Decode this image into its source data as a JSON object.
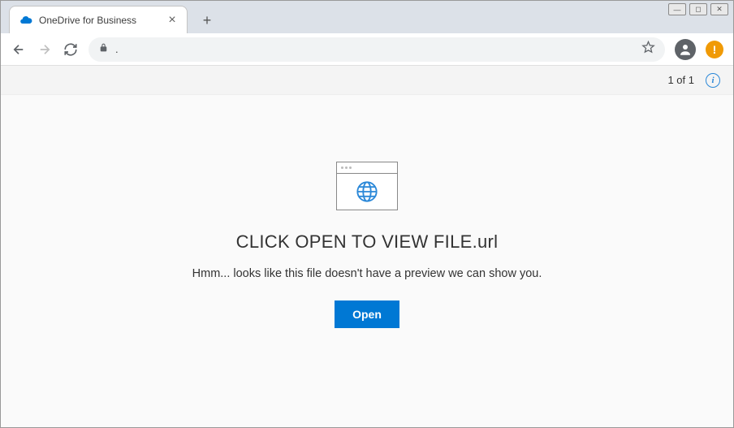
{
  "browser": {
    "window_controls": {
      "minimize": "—",
      "maximize": "◻",
      "close": "✕"
    },
    "tab_title": "OneDrive for Business",
    "address": ".",
    "new_tab_label": "+",
    "tab_close_label": "×"
  },
  "status": {
    "pager": "1 of 1",
    "info": "i"
  },
  "preview": {
    "file_title": "CLICK OPEN TO VIEW FILE.url",
    "message": "Hmm... looks like this file doesn't have a preview we can show you.",
    "open_button": "Open"
  },
  "alert_badge": "!"
}
